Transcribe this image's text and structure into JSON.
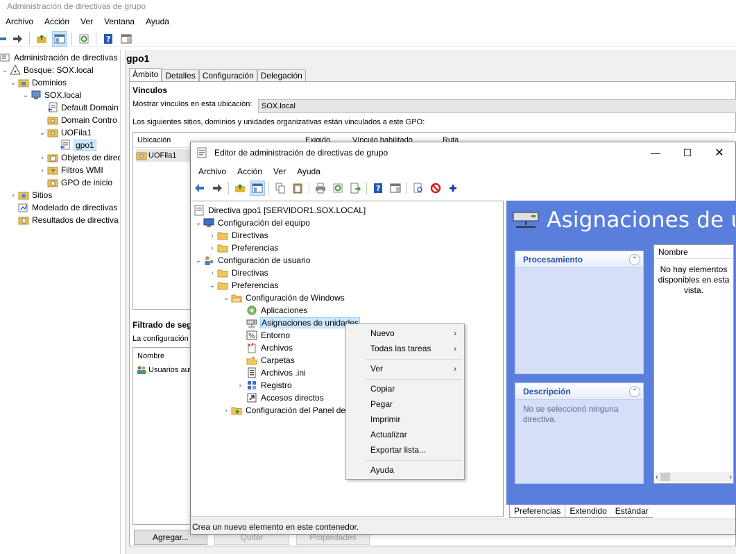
{
  "outer": {
    "title": "Administración de directivas de grupo",
    "menu": [
      "Archivo",
      "Acción",
      "Ver",
      "Ventana",
      "Ayuda"
    ],
    "tree": [
      {
        "label": "Administración de directivas d",
        "icon": "gpmc-icon"
      },
      {
        "label": "Bosque: SOX.local",
        "icon": "forest-icon"
      },
      {
        "label": "Dominios",
        "icon": "domains-folder-icon"
      },
      {
        "label": "SOX.local",
        "icon": "domain-icon"
      },
      {
        "label": "Default Domain",
        "icon": "gpo-link-icon"
      },
      {
        "label": "Domain Contro",
        "icon": "ou-icon"
      },
      {
        "label": "UOFila1",
        "icon": "ou-icon"
      },
      {
        "label": "gpo1",
        "icon": "gpo-link-icon"
      },
      {
        "label": "Objetos de direc",
        "icon": "gpo-folder-icon"
      },
      {
        "label": "Filtros WMI",
        "icon": "wmi-folder-icon"
      },
      {
        "label": "GPO de inicio",
        "icon": "starter-gpo-folder-icon"
      },
      {
        "label": "Sitios",
        "icon": "sites-icon"
      },
      {
        "label": "Modelado de directivas",
        "icon": "modeling-icon"
      },
      {
        "label": "Resultados de directiva",
        "icon": "results-icon"
      }
    ]
  },
  "gpo": {
    "title": "gpo1",
    "tabs": [
      "Ámbito",
      "Detalles",
      "Configuración",
      "Delegación"
    ],
    "links_heading": "Vínculos",
    "show_links_label": "Mostrar vínculos en esta ubicación:",
    "show_links_value": "SOX.local",
    "links_desc": "Los siguientes sitios, dominios y unidades organizativas están vinculados a este GPO:",
    "links_columns": [
      "Ubicación",
      "Exigido",
      "Vínculo habilitado",
      "Ruta"
    ],
    "links_rows": [
      {
        "location": "UOFila1"
      }
    ],
    "security_heading": "Filtrado de seg",
    "security_desc": "La configuración d",
    "security_column": "Nombre",
    "security_rows": [
      "Usuarios auto"
    ],
    "buttons": {
      "add": "Agregar...",
      "remove": "Quitar",
      "properties": "Propiedades"
    }
  },
  "editor": {
    "title": "Editor de administración de directivas de grupo",
    "menu": [
      "Archivo",
      "Acción",
      "Ver",
      "Ayuda"
    ],
    "tree": [
      {
        "label": "Directiva gpo1 [SERVIDOR1.SOX.LOCAL]",
        "icon": "policy-document-icon"
      },
      {
        "label": "Configuración del equipo",
        "icon": "computer-config-icon"
      },
      {
        "label": "Directivas",
        "icon": "folder-icon"
      },
      {
        "label": "Preferencias",
        "icon": "folder-icon"
      },
      {
        "label": "Configuración de usuario",
        "icon": "user-config-icon"
      },
      {
        "label": "Directivas",
        "icon": "folder-icon"
      },
      {
        "label": "Preferencias",
        "icon": "folder-icon"
      },
      {
        "label": "Configuración de Windows",
        "icon": "folder-open-icon"
      },
      {
        "label": "Aplicaciones",
        "icon": "applications-icon"
      },
      {
        "label": "Asignaciones de unidades",
        "icon": "drive-maps-icon"
      },
      {
        "label": "Entorno",
        "icon": "environment-icon"
      },
      {
        "label": "Archivos",
        "icon": "files-icon"
      },
      {
        "label": "Carpetas",
        "icon": "folders-icon"
      },
      {
        "label": "Archivos .ini",
        "icon": "ini-files-icon"
      },
      {
        "label": "Registro",
        "icon": "registry-icon"
      },
      {
        "label": "Accesos directos",
        "icon": "shortcuts-icon"
      },
      {
        "label": "Configuración del Panel de c",
        "icon": "control-panel-folder-icon"
      }
    ],
    "panel_title": "Asignaciones de unidades",
    "processing_label": "Procesamiento",
    "description_label": "Descripción",
    "description_text": "No se seleccionó ninguna directiva.",
    "list_column": "Nombre",
    "empty_text": "No hay elementos disponibles en esta vista.",
    "view_tabs": [
      "Preferencias",
      "Extendido",
      "Estándar"
    ],
    "status": "Crea un nuevo elemento en este contenedor."
  },
  "context_menu": [
    {
      "label": "Nuevo",
      "submenu": true
    },
    {
      "label": "Todas las tareas",
      "submenu": true
    },
    {
      "label": "Ver",
      "submenu": true
    },
    {
      "label": "Copiar"
    },
    {
      "label": "Pegar"
    },
    {
      "label": "Imprimir"
    },
    {
      "label": "Actualizar"
    },
    {
      "label": "Exportar lista..."
    },
    {
      "label": "Ayuda"
    }
  ],
  "colors": {
    "panel_blue": "#5a7edc",
    "task_header_text": "#2352a8",
    "selection": "#cce8ff"
  }
}
